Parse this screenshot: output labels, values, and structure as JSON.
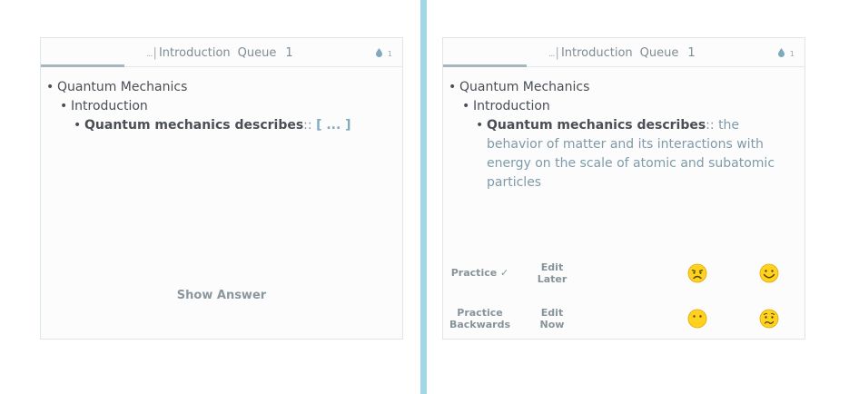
{
  "header": {
    "ellipsis": "...",
    "breadcrumb": "Introduction",
    "queue_label": "Queue",
    "queue_count": "1",
    "drop_count": "1",
    "progress": 0.23
  },
  "tree": {
    "root": "Quantum Mechanics",
    "child": "Introduction",
    "question": "Quantum mechanics describes",
    "separator": "::",
    "cloze": "[ ... ]",
    "answer": "the behavior of matter and its interactions with energy on the scale of atomic and subatomic particles"
  },
  "left_card": {
    "show_answer": "Show Answer"
  },
  "right_card": {
    "practice": "Practice ✓",
    "edit_later_1": "Edit",
    "edit_later_2": "Later",
    "practice_backwards_1": "Practice",
    "practice_backwards_2": "Backwards",
    "edit_now_1": "Edit",
    "edit_now_2": "Now",
    "icons": [
      "frowning-face-icon",
      "smiling-face-icon",
      "neutral-face-icon",
      "worried-face-icon"
    ]
  },
  "colors": {
    "divider": "#a3d7e8",
    "face": "#ffd21f",
    "accent": "#7fa9bd"
  }
}
